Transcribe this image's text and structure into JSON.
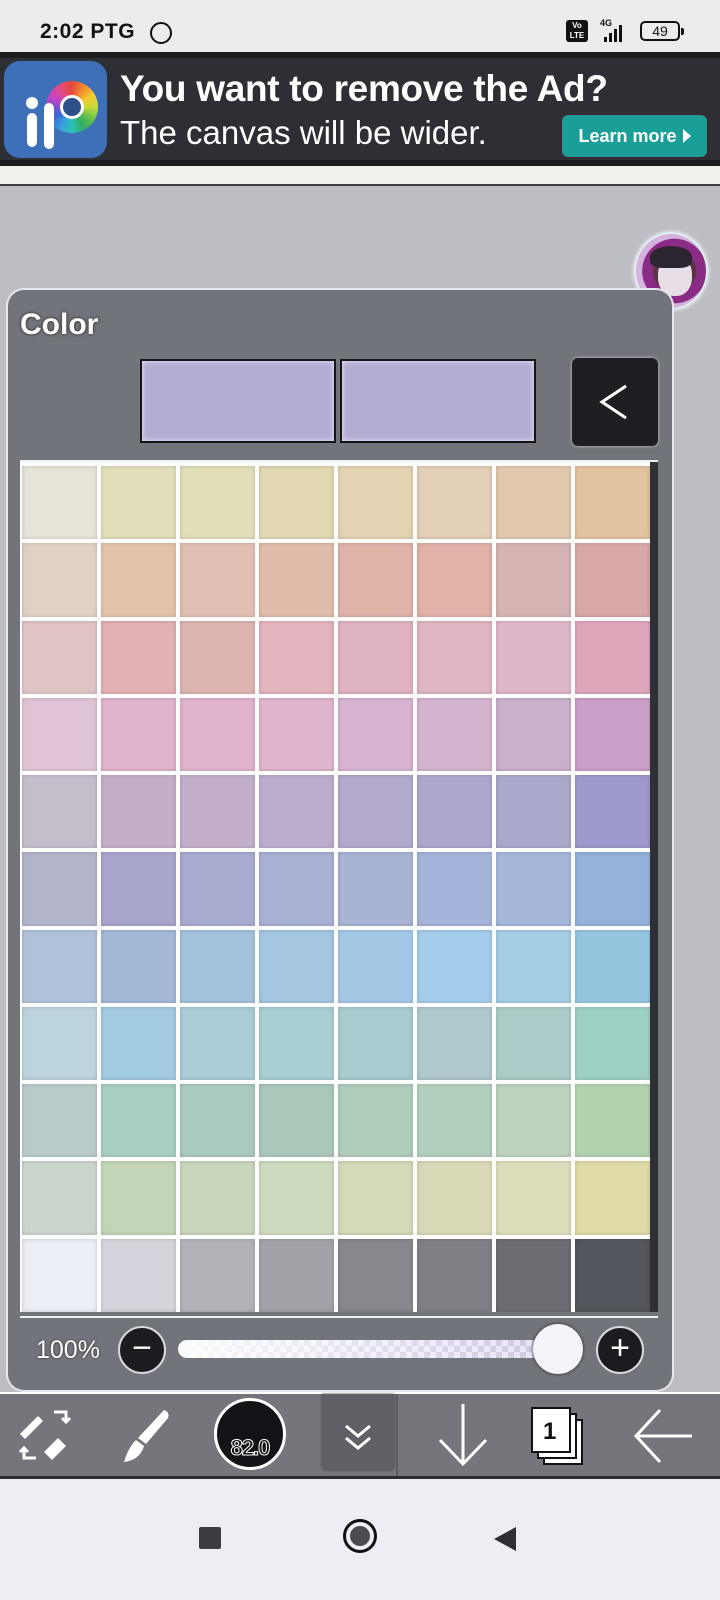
{
  "status_bar": {
    "time": "2:02 PTG",
    "volte_top": "Vo",
    "volte_bottom": "LTE",
    "network": "4G",
    "battery": "49"
  },
  "ad": {
    "title": "You want to remove the Ad?",
    "subtitle": "The canvas will be wider.",
    "button_label": "Learn more",
    "button_color": "#1a9e98"
  },
  "color_panel": {
    "title": "Color",
    "current_color": "#b4abd3",
    "previous_color": "#b5acd3",
    "opacity_label": "100%",
    "opacity_value_percent": 100,
    "palette_rows": [
      [
        "#e6e4d8",
        "#e2e0bb",
        "#e2dfb9",
        "#e2d8b3",
        "#e3d3b2",
        "#e4cfb7",
        "#e2c9ae",
        "#e4c3a0"
      ],
      [
        "#e2d0c4",
        "#e3c4ab",
        "#e2bfb3",
        "#e1bcab",
        "#e0b3a9",
        "#e2b1a8",
        "#d6b4b4",
        "#d9a8a8"
      ],
      [
        "#e1c4c6",
        "#e2b1b3",
        "#ddb4b0",
        "#e4b4be",
        "#dfb3c0",
        "#e0b6c2",
        "#e0b6c9",
        "#dfa7bc"
      ],
      [
        "#e0c4d6",
        "#e0b3cb",
        "#e1b3cd",
        "#e0b5cd",
        "#d8b4d3",
        "#d4b3cf",
        "#cab0cb",
        "#caa0c9"
      ],
      [
        "#c6bdcb",
        "#c6aecb",
        "#c3afcb",
        "#bcadcd",
        "#b3a9cc",
        "#aea7cd",
        "#aba9cb",
        "#9e99cb"
      ],
      [
        "#b3b5cc",
        "#a8a6cc",
        "#a8abd0",
        "#a8b1d3",
        "#a8b4d3",
        "#a5b4da",
        "#a5b8dc",
        "#95b2db"
      ],
      [
        "#b0c2d9",
        "#a4b9d8",
        "#a3c2dc",
        "#a4c6e0",
        "#a3c8e6",
        "#a4cdeb",
        "#a4cde3",
        "#95c6e0"
      ],
      [
        "#bcd4e0",
        "#a3cbe2",
        "#a9ccd7",
        "#a8cfd4",
        "#a8ccd0",
        "#afc9cf",
        "#abcbc8",
        "#9ed0c6"
      ],
      [
        "#b9cccb",
        "#a8cfc3",
        "#a9cbbf",
        "#aac8b9",
        "#afcdbb",
        "#b2d0bd",
        "#bdd3bd",
        "#b2d3ad"
      ],
      [
        "#cbd5cc",
        "#c2d5b6",
        "#c8d6bc",
        "#ccdabe",
        "#d3dab8",
        "#dad9b7",
        "#deddbb",
        "#e0dca8"
      ],
      [
        "#eceef6",
        "#d4d5dc",
        "#b1b3b9",
        "#a1a3a8",
        "#86888e",
        "#7e8086",
        "#6b6d73",
        "#53565c"
      ]
    ]
  },
  "toolbar": {
    "brush_size": "82.0",
    "layer_count": "1"
  }
}
